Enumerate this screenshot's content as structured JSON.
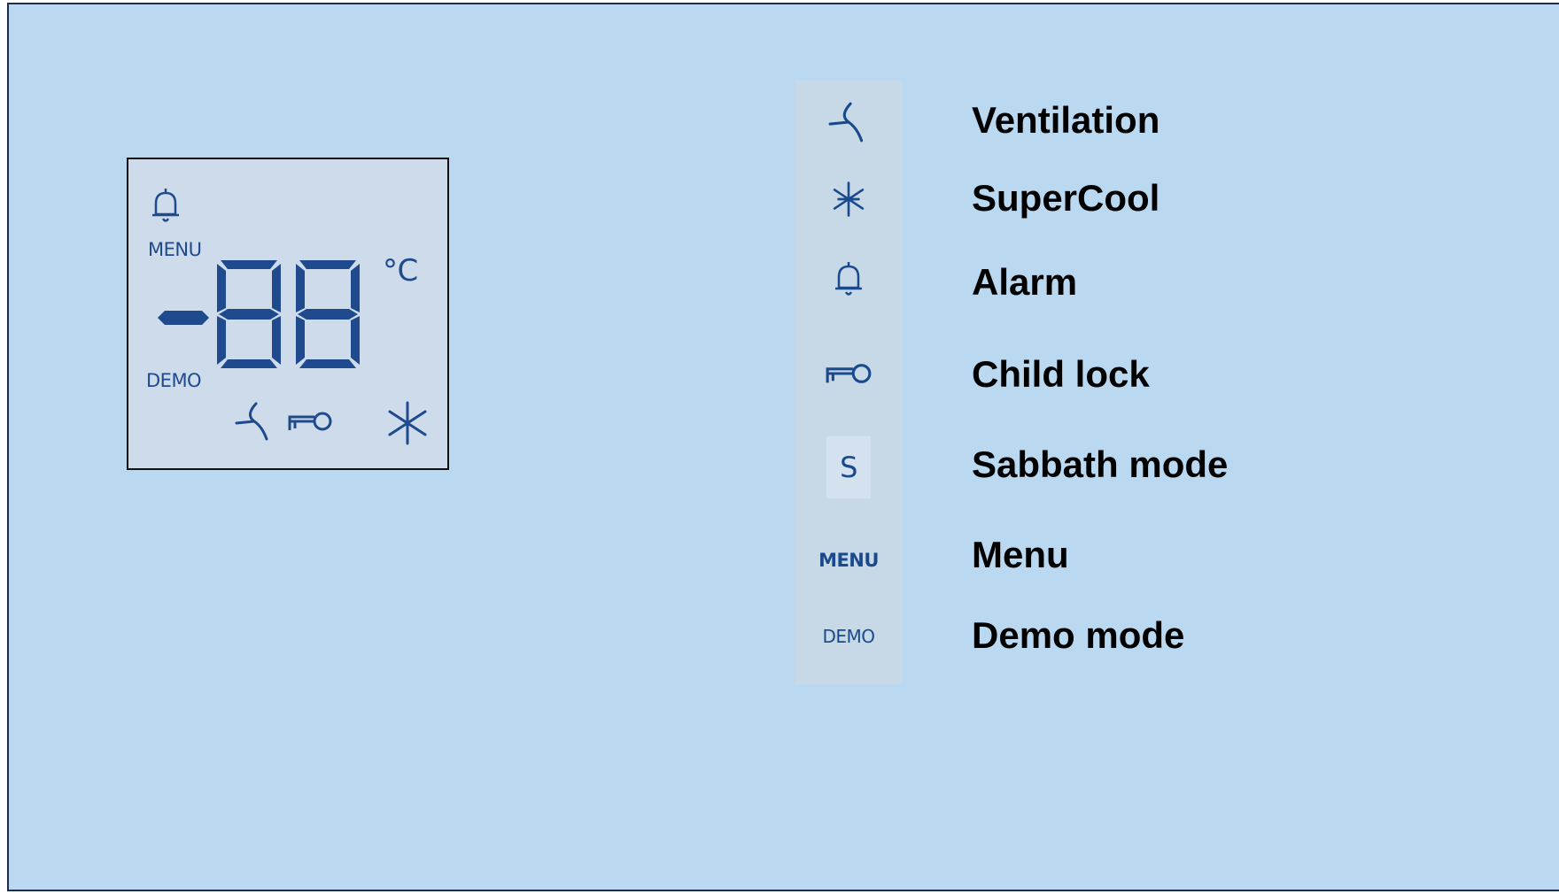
{
  "lcd": {
    "menu_text": "MENU",
    "demo_text": "DEMO",
    "temp_minus": "-",
    "temp_digits": "88",
    "unit": "°C",
    "icons": [
      "bell-icon",
      "fan-icon",
      "key-icon",
      "snowflake-icon"
    ]
  },
  "legend": {
    "items": [
      {
        "icon": "fan-icon",
        "label": "Ventilation"
      },
      {
        "icon": "snowflake-icon",
        "label": "SuperCool"
      },
      {
        "icon": "bell-icon",
        "label": "Alarm"
      },
      {
        "icon": "key-icon",
        "label": "Child lock"
      },
      {
        "icon": "sabbath-icon",
        "icon_text": "S",
        "label": "Sabbath mode"
      },
      {
        "icon": "menu-icon",
        "icon_text": "MENU",
        "label": "Menu"
      },
      {
        "icon": "demo-icon",
        "icon_text": "DEMO",
        "label": "Demo mode"
      }
    ]
  },
  "colors": {
    "background": "#bad8f0",
    "lcd_background": "#cddbea",
    "lcd_segment": "#1f4a8e",
    "strip_background": "#c7d8e7"
  }
}
